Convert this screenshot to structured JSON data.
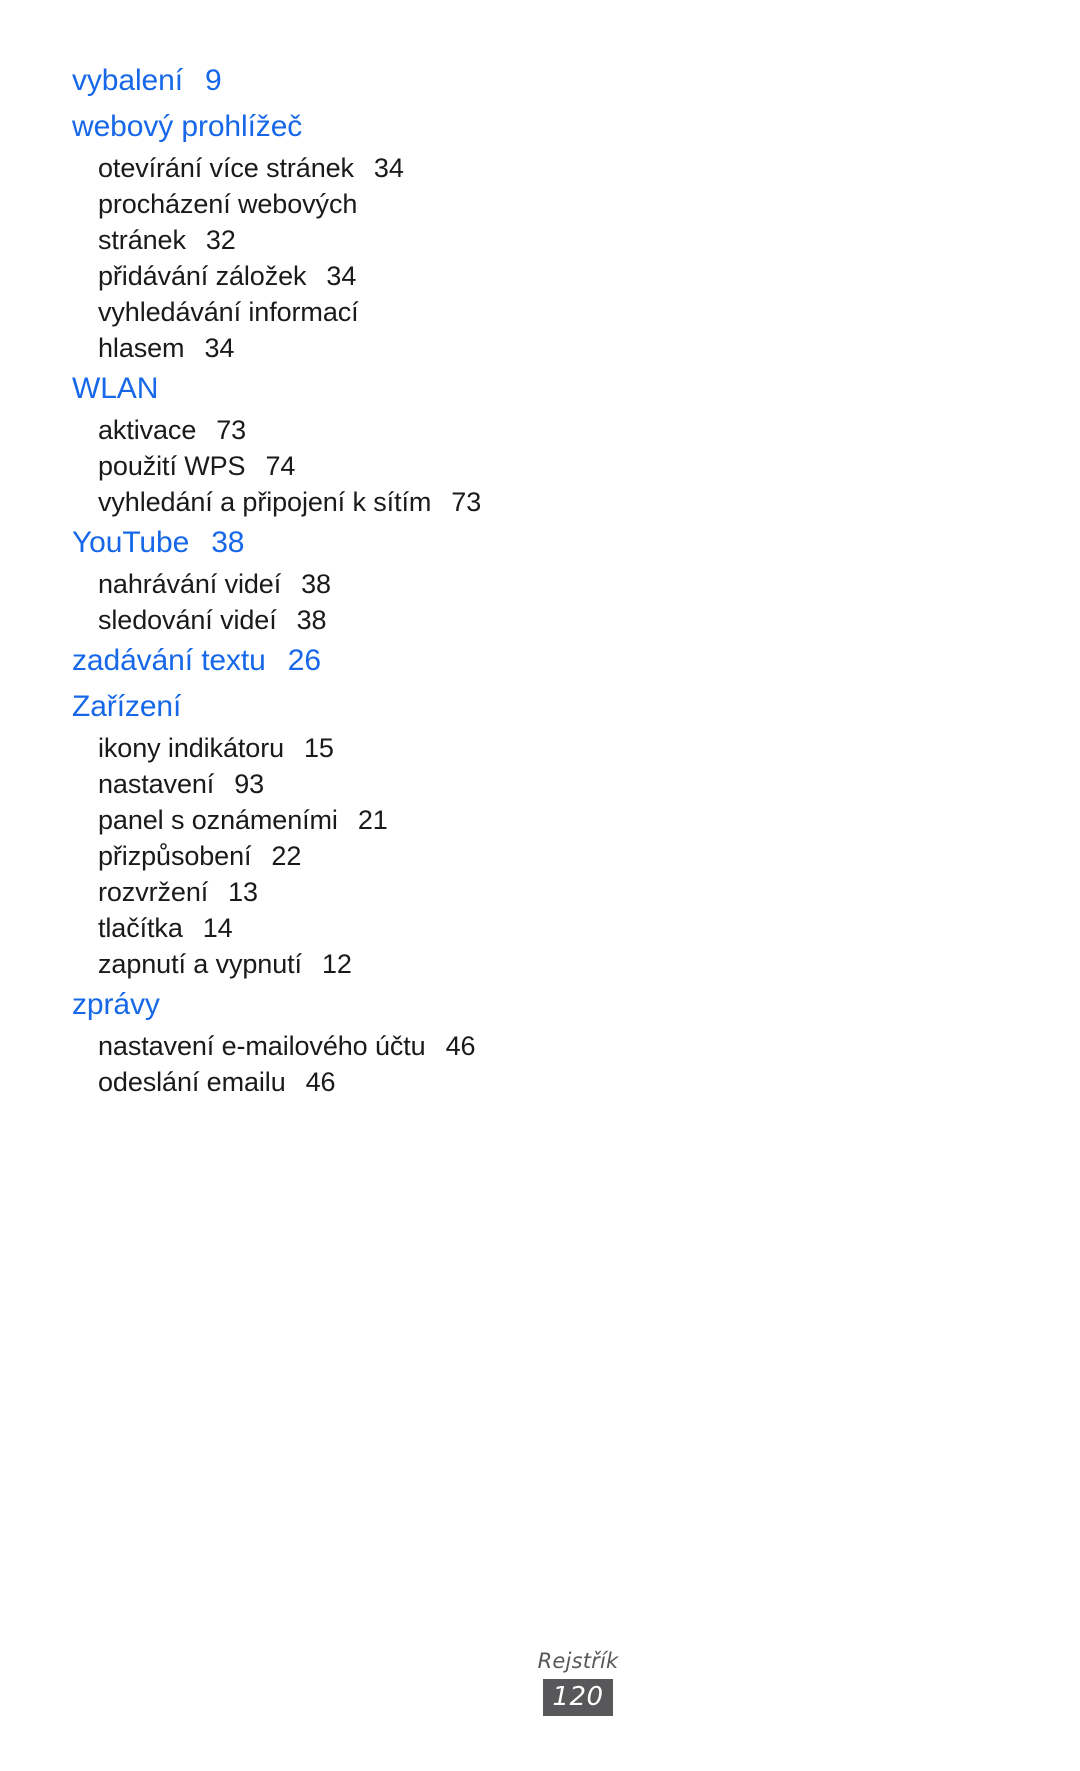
{
  "document": {
    "language": "cs",
    "heading_color": "#1668e8",
    "body_color": "#1a1a1a",
    "footer_color": "#58585a"
  },
  "index": {
    "groups": [
      {
        "heading": "vybalení",
        "heading_page": "9",
        "entries": []
      },
      {
        "heading": "webový prohlížeč",
        "heading_page": "",
        "entries": [
          {
            "label": "otevírání více stránek",
            "page": "34"
          },
          {
            "label": "procházení webových stránek",
            "page": "32"
          },
          {
            "label": "přidávání záložek",
            "page": "34"
          },
          {
            "label": "vyhledávání informací hlasem",
            "page": "34"
          }
        ]
      },
      {
        "heading": "WLAN",
        "heading_page": "",
        "entries": [
          {
            "label": "aktivace",
            "page": "73"
          },
          {
            "label": "použití WPS",
            "page": "74"
          },
          {
            "label": "vyhledání a připojení k sítím",
            "page": "73"
          }
        ]
      },
      {
        "heading": "YouTube",
        "heading_page": "38",
        "entries": [
          {
            "label": "nahrávání videí",
            "page": "38"
          },
          {
            "label": "sledování videí",
            "page": "38"
          }
        ]
      },
      {
        "heading": "zadávání textu",
        "heading_page": "26",
        "entries": []
      },
      {
        "heading": "Zařízení",
        "heading_page": "",
        "entries": [
          {
            "label": "ikony indikátoru",
            "page": "15"
          },
          {
            "label": "nastavení",
            "page": "93"
          },
          {
            "label": "panel s oznámeními",
            "page": "21"
          },
          {
            "label": "přizpůsobení",
            "page": "22"
          },
          {
            "label": "rozvržení",
            "page": "13"
          },
          {
            "label": "tlačítka",
            "page": "14"
          },
          {
            "label": "zapnutí a vypnutí",
            "page": "12"
          }
        ]
      },
      {
        "heading": "zprávy",
        "heading_page": "",
        "entries": [
          {
            "label": "nastavení e-mailového účtu",
            "page": "46"
          },
          {
            "label": "odeslání emailu",
            "page": "46"
          }
        ]
      }
    ]
  },
  "footer": {
    "section_title": "Rejstřík",
    "page_number": "120"
  }
}
